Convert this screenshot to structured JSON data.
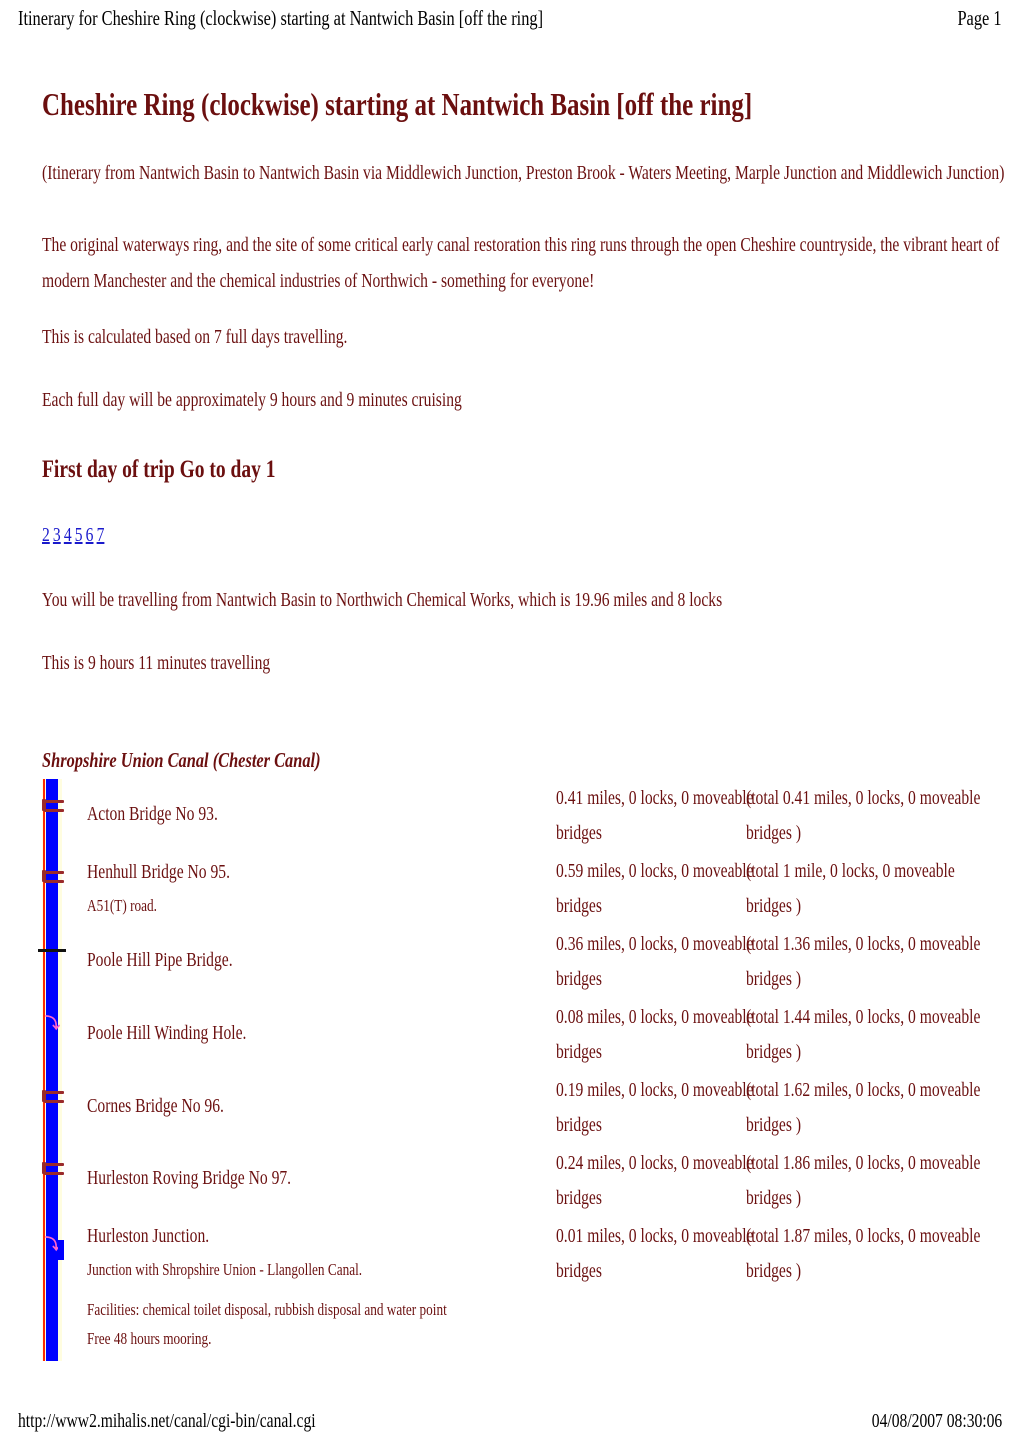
{
  "print_header": {
    "title": "Itinerary for Cheshire Ring (clockwise) starting at Nantwich Basin [off the ring]",
    "page": "Page 1"
  },
  "page_title": "Cheshire Ring (clockwise) starting at Nantwich Basin [off the ring]",
  "intro_route": "(Itinerary from Nantwich Basin to Nantwich Basin via Middlewich Junction, Preston Brook - Waters Meeting, Marple Junction and Middlewich Junction)",
  "description_line1": "The original waterways ring, and the site of some critical early canal restoration this ring runs through the open Cheshire countryside, the vibrant heart of",
  "description_line2": "modern Manchester and the chemical industries of Northwich - something for everyone!",
  "days_basis": "This is calculated based on 7 full days travelling.",
  "day_length": "Each full day will be approximately 9 hours and 9 minutes cruising",
  "day_heading": "First day of trip Go to day 1",
  "day_links": [
    "2",
    "3",
    "4",
    "5",
    "6",
    "7"
  ],
  "travel_summary": "You will be travelling from Nantwich Basin to Northwich Chemical Works, which is 19.96 miles and 8 locks",
  "travel_time": "This is 9 hours 11 minutes travelling",
  "canal": {
    "name": "Shropshire Union Canal (Chester Canal)",
    "colors": {
      "water": "#0000ff",
      "bank": "#ff2a00",
      "towpath": "#fffde0",
      "bridge": "#9a2a2a",
      "winding": "#ff66cc"
    },
    "entries": [
      {
        "icon": "bridge-icon",
        "name": "Acton Bridge No 93.",
        "sub": "",
        "leg_line1": "0.41 miles, 0 locks, 0 moveable",
        "leg_line2": "bridges",
        "total_line1": "(total 0.41 miles, 0 locks, 0 moveable",
        "total_line2": "bridges )"
      },
      {
        "icon": "bridge-icon",
        "name": "Henhull Bridge No 95.",
        "sub": "A51(T) road.",
        "leg_line1": "0.59 miles, 0 locks, 0 moveable",
        "leg_line2": "bridges",
        "total_line1": "(total 1 mile, 0 locks, 0 moveable",
        "total_line2": "bridges )"
      },
      {
        "icon": "pipe-bridge-icon",
        "name": "Poole Hill Pipe Bridge.",
        "sub": "",
        "leg_line1": "0.36 miles, 0 locks, 0 moveable",
        "leg_line2": "bridges",
        "total_line1": "(total 1.36 miles, 0 locks, 0 moveable",
        "total_line2": "bridges )"
      },
      {
        "icon": "winding-hole-icon",
        "name": "Poole Hill Winding Hole.",
        "sub": "",
        "leg_line1": "0.08 miles, 0 locks, 0 moveable",
        "leg_line2": "bridges",
        "total_line1": "(total 1.44 miles, 0 locks, 0 moveable",
        "total_line2": "bridges )"
      },
      {
        "icon": "bridge-icon",
        "name": "Cornes Bridge No 96.",
        "sub": "",
        "leg_line1": "0.19 miles, 0 locks, 0 moveable",
        "leg_line2": "bridges",
        "total_line1": "(total 1.62 miles, 0 locks, 0 moveable",
        "total_line2": "bridges )"
      },
      {
        "icon": "bridge-icon",
        "name": "Hurleston Roving Bridge No 97.",
        "sub": "",
        "leg_line1": "0.24 miles, 0 locks, 0 moveable",
        "leg_line2": "bridges",
        "total_line1": "(total 1.86 miles, 0 locks, 0 moveable",
        "total_line2": "bridges )"
      },
      {
        "icon": "junction-icon",
        "name": "Hurleston Junction.",
        "sub": "Junction with Shropshire Union - Llangollen Canal.",
        "leg_line1": "0.01 miles, 0 locks, 0 moveable",
        "leg_line2": "bridges",
        "total_line1": "(total 1.87 miles, 0 locks, 0 moveable",
        "total_line2": "bridges )"
      }
    ],
    "facilities": "Facilities: chemical toilet disposal, rubbish disposal and water point",
    "mooring": "Free 48 hours mooring."
  },
  "print_footer": {
    "url": "http://www2.mihalis.net/canal/cgi-bin/canal.cgi",
    "datetime": "04/08/2007 08:30:06"
  }
}
